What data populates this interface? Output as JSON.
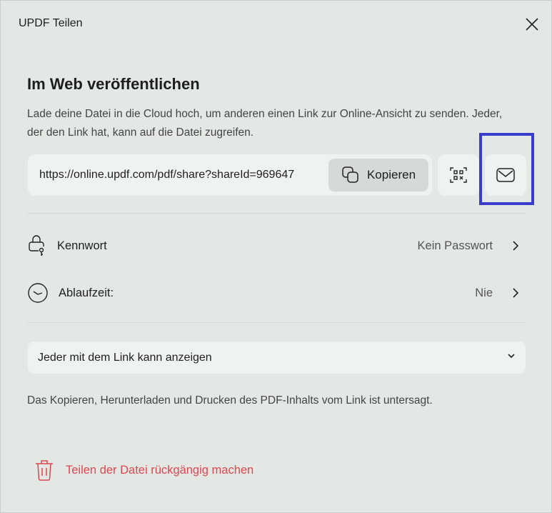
{
  "window": {
    "title": "UPDF Teilen"
  },
  "section": {
    "title": "Im Web veröffentlichen",
    "description": "Lade deine Datei in die Cloud hoch, um anderen einen Link zur Online-Ansicht zu senden. Jeder, der den Link hat, kann auf die Datei zugreifen."
  },
  "link": {
    "url": "https://online.updf.com/pdf/share?shareId=969647",
    "copy_label": "Kopieren"
  },
  "settings": {
    "password": {
      "label": "Kennwort",
      "value": "Kein Passwort"
    },
    "expiry": {
      "label": "Ablaufzeit:",
      "value": "Nie"
    }
  },
  "permission": {
    "selected": "Jeder mit dem Link kann anzeigen"
  },
  "note": "Das Kopieren, Herunterladen und Drucken des PDF-Inhalts vom Link ist untersagt.",
  "revoke_label": "Teilen der Datei rückgängig machen",
  "colors": {
    "highlight": "#3a3dcc",
    "danger": "#e0464f"
  }
}
